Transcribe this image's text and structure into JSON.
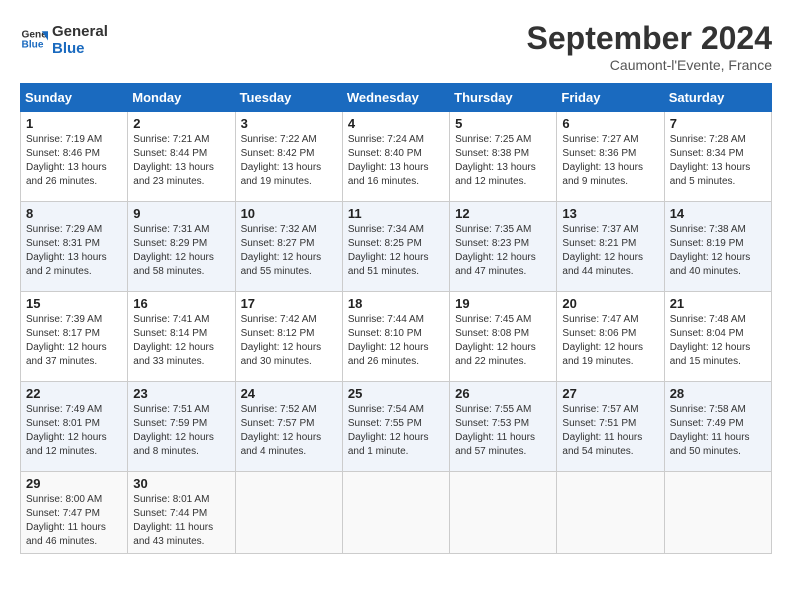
{
  "header": {
    "logo_line1": "General",
    "logo_line2": "Blue",
    "month": "September 2024",
    "location": "Caumont-l'Evente, France"
  },
  "days_of_week": [
    "Sunday",
    "Monday",
    "Tuesday",
    "Wednesday",
    "Thursday",
    "Friday",
    "Saturday"
  ],
  "weeks": [
    [
      {
        "day": "1",
        "info": "Sunrise: 7:19 AM\nSunset: 8:46 PM\nDaylight: 13 hours\nand 26 minutes."
      },
      {
        "day": "2",
        "info": "Sunrise: 7:21 AM\nSunset: 8:44 PM\nDaylight: 13 hours\nand 23 minutes."
      },
      {
        "day": "3",
        "info": "Sunrise: 7:22 AM\nSunset: 8:42 PM\nDaylight: 13 hours\nand 19 minutes."
      },
      {
        "day": "4",
        "info": "Sunrise: 7:24 AM\nSunset: 8:40 PM\nDaylight: 13 hours\nand 16 minutes."
      },
      {
        "day": "5",
        "info": "Sunrise: 7:25 AM\nSunset: 8:38 PM\nDaylight: 13 hours\nand 12 minutes."
      },
      {
        "day": "6",
        "info": "Sunrise: 7:27 AM\nSunset: 8:36 PM\nDaylight: 13 hours\nand 9 minutes."
      },
      {
        "day": "7",
        "info": "Sunrise: 7:28 AM\nSunset: 8:34 PM\nDaylight: 13 hours\nand 5 minutes."
      }
    ],
    [
      {
        "day": "8",
        "info": "Sunrise: 7:29 AM\nSunset: 8:31 PM\nDaylight: 13 hours\nand 2 minutes."
      },
      {
        "day": "9",
        "info": "Sunrise: 7:31 AM\nSunset: 8:29 PM\nDaylight: 12 hours\nand 58 minutes."
      },
      {
        "day": "10",
        "info": "Sunrise: 7:32 AM\nSunset: 8:27 PM\nDaylight: 12 hours\nand 55 minutes."
      },
      {
        "day": "11",
        "info": "Sunrise: 7:34 AM\nSunset: 8:25 PM\nDaylight: 12 hours\nand 51 minutes."
      },
      {
        "day": "12",
        "info": "Sunrise: 7:35 AM\nSunset: 8:23 PM\nDaylight: 12 hours\nand 47 minutes."
      },
      {
        "day": "13",
        "info": "Sunrise: 7:37 AM\nSunset: 8:21 PM\nDaylight: 12 hours\nand 44 minutes."
      },
      {
        "day": "14",
        "info": "Sunrise: 7:38 AM\nSunset: 8:19 PM\nDaylight: 12 hours\nand 40 minutes."
      }
    ],
    [
      {
        "day": "15",
        "info": "Sunrise: 7:39 AM\nSunset: 8:17 PM\nDaylight: 12 hours\nand 37 minutes."
      },
      {
        "day": "16",
        "info": "Sunrise: 7:41 AM\nSunset: 8:14 PM\nDaylight: 12 hours\nand 33 minutes."
      },
      {
        "day": "17",
        "info": "Sunrise: 7:42 AM\nSunset: 8:12 PM\nDaylight: 12 hours\nand 30 minutes."
      },
      {
        "day": "18",
        "info": "Sunrise: 7:44 AM\nSunset: 8:10 PM\nDaylight: 12 hours\nand 26 minutes."
      },
      {
        "day": "19",
        "info": "Sunrise: 7:45 AM\nSunset: 8:08 PM\nDaylight: 12 hours\nand 22 minutes."
      },
      {
        "day": "20",
        "info": "Sunrise: 7:47 AM\nSunset: 8:06 PM\nDaylight: 12 hours\nand 19 minutes."
      },
      {
        "day": "21",
        "info": "Sunrise: 7:48 AM\nSunset: 8:04 PM\nDaylight: 12 hours\nand 15 minutes."
      }
    ],
    [
      {
        "day": "22",
        "info": "Sunrise: 7:49 AM\nSunset: 8:01 PM\nDaylight: 12 hours\nand 12 minutes."
      },
      {
        "day": "23",
        "info": "Sunrise: 7:51 AM\nSunset: 7:59 PM\nDaylight: 12 hours\nand 8 minutes."
      },
      {
        "day": "24",
        "info": "Sunrise: 7:52 AM\nSunset: 7:57 PM\nDaylight: 12 hours\nand 4 minutes."
      },
      {
        "day": "25",
        "info": "Sunrise: 7:54 AM\nSunset: 7:55 PM\nDaylight: 12 hours\nand 1 minute."
      },
      {
        "day": "26",
        "info": "Sunrise: 7:55 AM\nSunset: 7:53 PM\nDaylight: 11 hours\nand 57 minutes."
      },
      {
        "day": "27",
        "info": "Sunrise: 7:57 AM\nSunset: 7:51 PM\nDaylight: 11 hours\nand 54 minutes."
      },
      {
        "day": "28",
        "info": "Sunrise: 7:58 AM\nSunset: 7:49 PM\nDaylight: 11 hours\nand 50 minutes."
      }
    ],
    [
      {
        "day": "29",
        "info": "Sunrise: 8:00 AM\nSunset: 7:47 PM\nDaylight: 11 hours\nand 46 minutes."
      },
      {
        "day": "30",
        "info": "Sunrise: 8:01 AM\nSunset: 7:44 PM\nDaylight: 11 hours\nand 43 minutes."
      },
      {
        "day": "",
        "info": ""
      },
      {
        "day": "",
        "info": ""
      },
      {
        "day": "",
        "info": ""
      },
      {
        "day": "",
        "info": ""
      },
      {
        "day": "",
        "info": ""
      }
    ]
  ]
}
